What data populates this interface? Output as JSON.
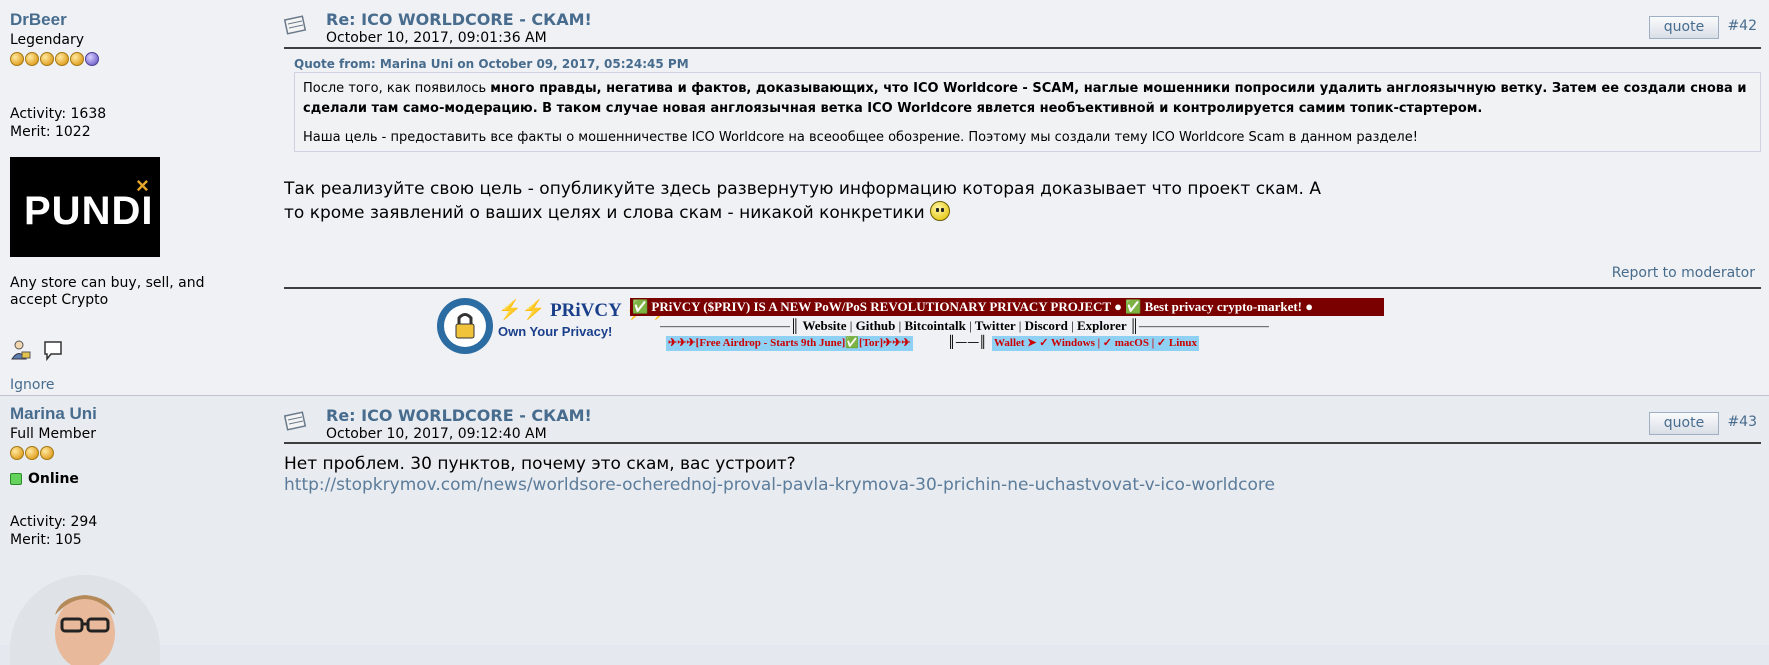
{
  "posts": [
    {
      "username": "DrBeer",
      "rank": "Legendary",
      "stats": {
        "activity": "Activity: 1638",
        "merit": "Merit: 1022"
      },
      "avatar_text": "PUNDI",
      "signature_text": "Any store can buy, sell, and accept Crypto",
      "ignore_label": "Ignore",
      "subject": "Re: ICO WORLDCORE - СКАМ!",
      "date": "October 10, 2017, 09:01:36 AM",
      "quote_label": "quote",
      "msg_num": "#42",
      "quote": {
        "header": "Quote from: Marina Uni on October 09, 2017, 05:24:45 PM",
        "p1_a": "После того, как появилось ",
        "p1_b": "много правды, негатива и фактов, доказывающих, что ICO Worldcore - SCAM, наглые мошенники попросили удалить англоязычную ветку. Затем ее создали снова и сделали там само-модерацию. В таком случае новая англоязычная ветка ICO Worldcore явлется необъективной и контролируется самим топик-стартером.",
        "p2": "Наша цель - предоставить все факты о мошенничестве  ICO Worldcore  на всеообщее обозрение. Поэтому мы создали тему ICO Worldcore Scam в данном разделе!"
      },
      "body": "Так реализуйте свою цель - опубликуйте здесь развернутую информацию которая доказывает что проект скам. А то кроме заявлений о ваших целях и слова скам - никакой конкретики",
      "report_label": "Report to moderator",
      "banner": {
        "brand": "⚡⚡ PRiVCY ⚡⚡",
        "slogan": "Own Your Privacy!",
        "headline": "✅ PRiVCY ($PRIV) IS A NEW PoW/PoS REVOLUTIONARY PRIVACY PROJECT ● ✅ Best privacy crypto-market! ●",
        "links": [
          "Website",
          "Github",
          "Bitcointalk",
          "Twitter",
          "Discord",
          "Explorer"
        ],
        "airdrop": "✈✈✈[Free Airdrop - Starts 9th June]✅[Tor]✈✈✈",
        "wallet": "Wallet ➤ ✓ Windows  |  ✓ macOS  |  ✓ Linux"
      }
    },
    {
      "username": "Marina Uni",
      "rank": "Full Member",
      "online_label": "Online",
      "stats": {
        "activity": "Activity: 294",
        "merit": "Merit: 105"
      },
      "subject": "Re: ICO WORLDCORE - СКАМ!",
      "date": "October 10, 2017, 09:12:40 AM",
      "quote_label": "quote",
      "msg_num": "#43",
      "body": "Нет проблем. 30 пунктов, почему это скам, вас устроит?",
      "link": "http://stopkrymov.com/news/worldsore-ocherednoj-proval-pavla-krymova-30-prichin-ne-uchastvovat-v-ico-worldcore"
    }
  ],
  "colors": {
    "accent": "#476c8e",
    "banner_red": "#7a0000",
    "banner_blue": "#8fd0f5"
  }
}
